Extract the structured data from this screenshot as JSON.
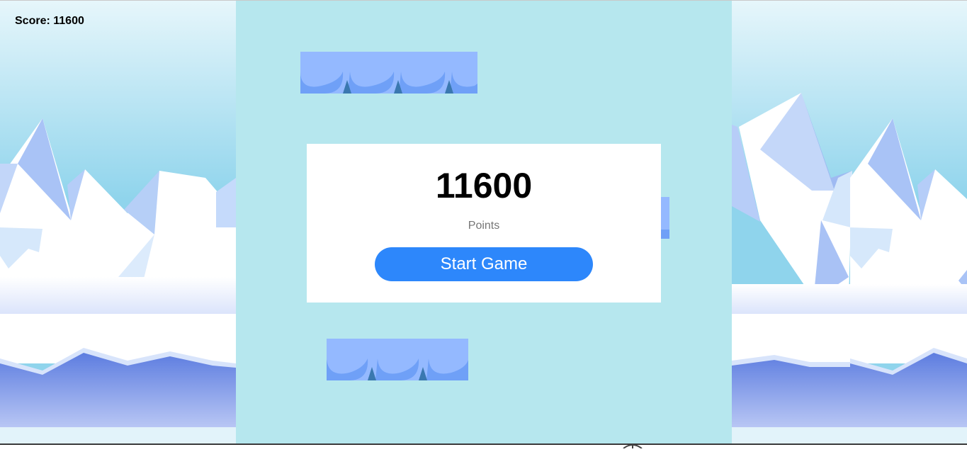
{
  "hud": {
    "score_prefix": "Score: ",
    "score_value": "11600"
  },
  "modal": {
    "points": "11600",
    "points_label": "Points",
    "start_button": "Start Game"
  },
  "colors": {
    "game_background": "#b6e7ee",
    "platform": "#94b9ff",
    "platform_dark": "#6fa0f7",
    "button": "#2d87fb",
    "sky_top": "#e6f6fb",
    "sky_bottom": "#8fd4ec",
    "water": "#6d8ee6"
  },
  "icons": {
    "mountain_background": "snowy-mountains-image",
    "platform": "ice-platform",
    "bottom_partial": "wheel-icon"
  }
}
